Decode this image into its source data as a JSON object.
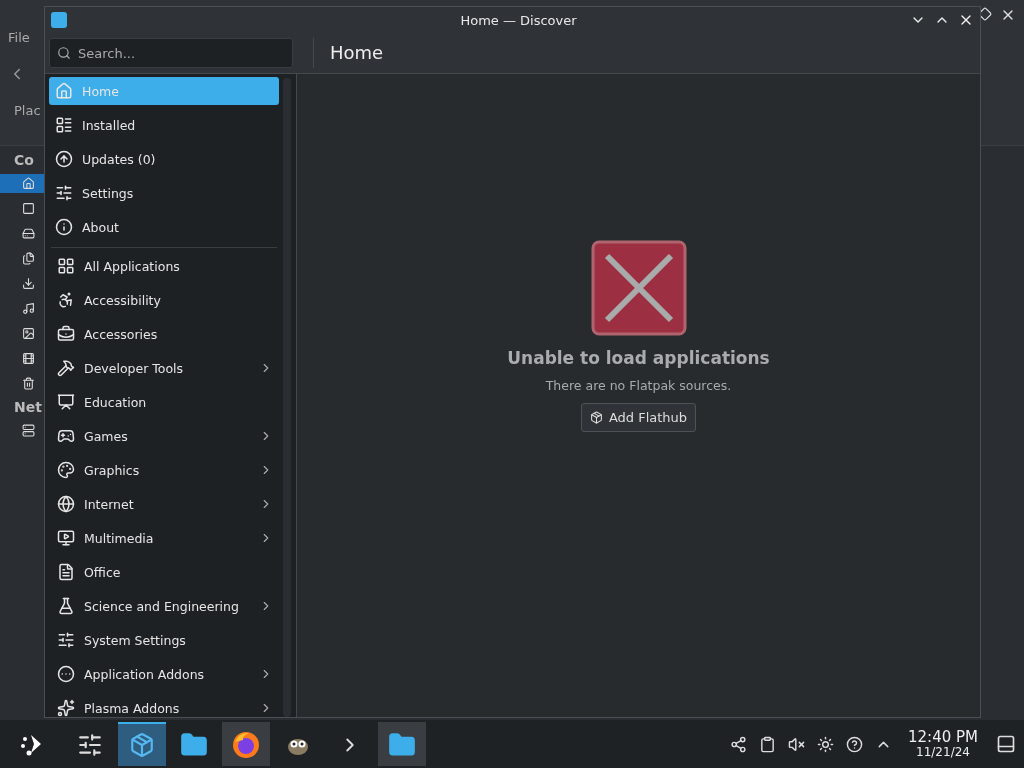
{
  "background_window": {
    "menu": "File",
    "places_label": "Plac",
    "sections": [
      "Co",
      "Net"
    ]
  },
  "window": {
    "title": "Home — Discover"
  },
  "search": {
    "placeholder": "Search..."
  },
  "page_title": "Home",
  "nav": [
    {
      "label": "Home",
      "selected": true
    },
    {
      "label": "Installed",
      "selected": false
    },
    {
      "label": "Updates (0)",
      "selected": false
    },
    {
      "label": "Settings",
      "selected": false
    },
    {
      "label": "About",
      "selected": false
    }
  ],
  "categories": [
    {
      "label": "All Applications",
      "selected": false,
      "submenu": false
    },
    {
      "label": "Accessibility",
      "selected": false,
      "submenu": false
    },
    {
      "label": "Accessories",
      "selected": false,
      "submenu": false
    },
    {
      "label": "Developer Tools",
      "selected": false,
      "submenu": true
    },
    {
      "label": "Education",
      "selected": false,
      "submenu": false
    },
    {
      "label": "Games",
      "selected": false,
      "submenu": true
    },
    {
      "label": "Graphics",
      "selected": false,
      "submenu": true
    },
    {
      "label": "Internet",
      "selected": false,
      "submenu": true
    },
    {
      "label": "Multimedia",
      "selected": false,
      "submenu": true
    },
    {
      "label": "Office",
      "selected": false,
      "submenu": false
    },
    {
      "label": "Science and Engineering",
      "selected": false,
      "submenu": true
    },
    {
      "label": "System Settings",
      "selected": false,
      "submenu": false
    },
    {
      "label": "Application Addons",
      "selected": false,
      "submenu": true
    },
    {
      "label": "Plasma Addons",
      "selected": false,
      "submenu": true
    }
  ],
  "error": {
    "title": "Unable to load applications",
    "message": "There are no Flatpak sources.",
    "button": "Add Flathub"
  },
  "taskbar": {
    "apps": [
      {
        "selected": false,
        "running": false
      },
      {
        "selected": true,
        "running": true
      },
      {
        "selected": false,
        "running": false
      },
      {
        "selected": false,
        "running": true
      },
      {
        "selected": false,
        "running": false
      },
      {
        "selected": false,
        "running": false
      },
      {
        "selected": false,
        "running": true
      }
    ],
    "time": "12:40 PM",
    "date": "11/21/24"
  }
}
